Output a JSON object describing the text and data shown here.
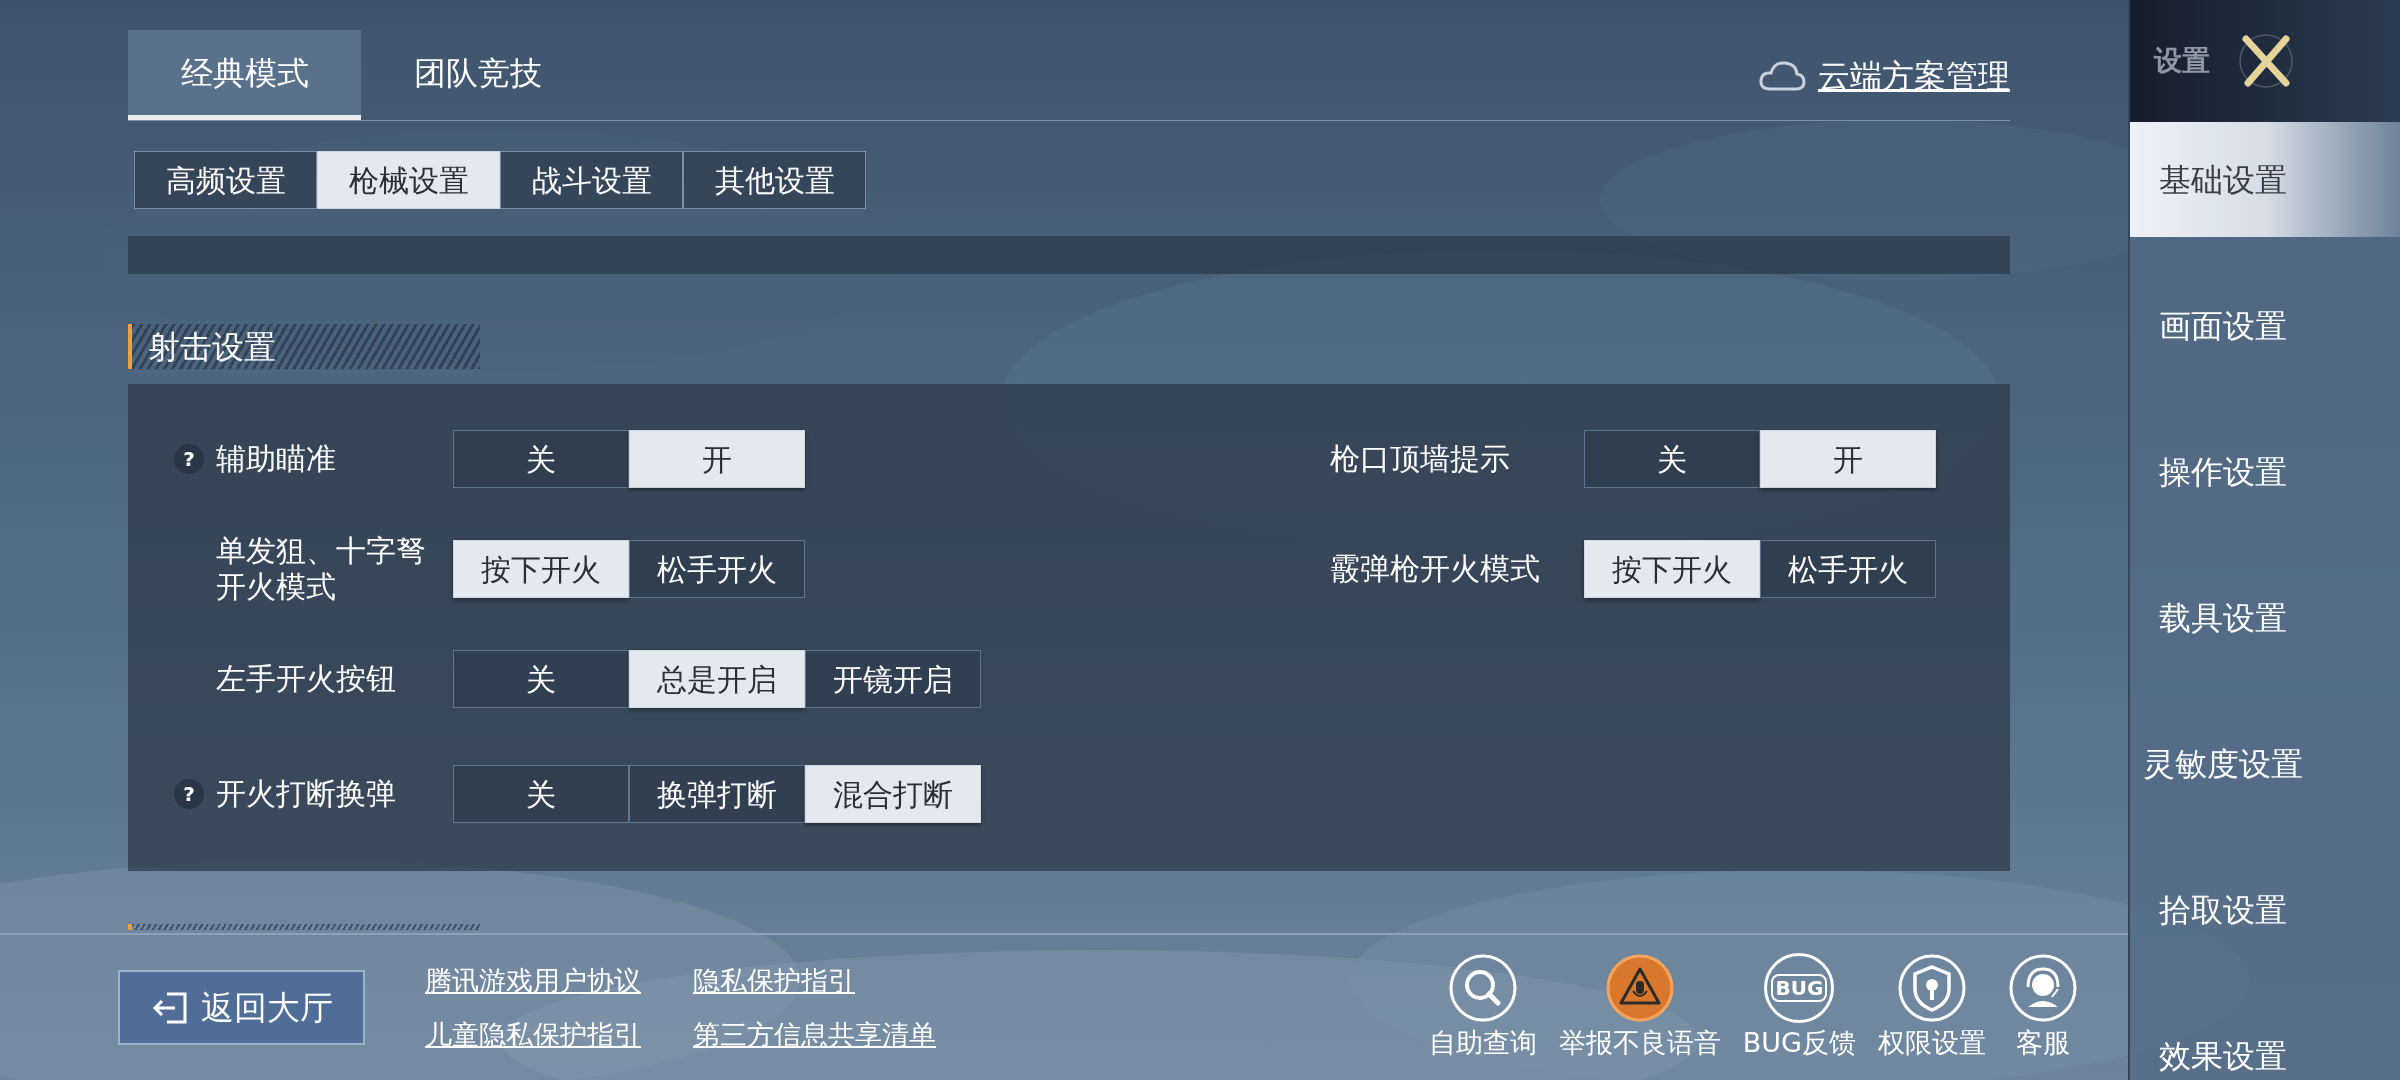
{
  "mode_tabs": [
    {
      "label": "经典模式",
      "selected": true
    },
    {
      "label": "团队竞技",
      "selected": false
    }
  ],
  "cloud_link": "云端方案管理",
  "sub_tabs": [
    {
      "label": "高频设置",
      "selected": false
    },
    {
      "label": "枪械设置",
      "selected": true
    },
    {
      "label": "战斗设置",
      "selected": false
    },
    {
      "label": "其他设置",
      "selected": false
    }
  ],
  "section": {
    "title": "射击设置",
    "rows": [
      {
        "left": {
          "label": "辅助瞄准",
          "help": "?",
          "options": [
            {
              "label": "关",
              "selected": false
            },
            {
              "label": "开",
              "selected": true
            }
          ]
        },
        "right": {
          "label": "枪口顶墙提示",
          "options": [
            {
              "label": "关",
              "selected": false
            },
            {
              "label": "开",
              "selected": true
            }
          ]
        }
      },
      {
        "left": {
          "label": "单发狙、十字弩开火模式",
          "options": [
            {
              "label": "按下开火",
              "selected": true
            },
            {
              "label": "松手开火",
              "selected": false
            }
          ]
        },
        "right": {
          "label": "霰弹枪开火模式",
          "options": [
            {
              "label": "按下开火",
              "selected": true
            },
            {
              "label": "松手开火",
              "selected": false
            }
          ]
        }
      },
      {
        "left": {
          "label": "左手开火按钮",
          "options": [
            {
              "label": "关",
              "selected": false
            },
            {
              "label": "总是开启",
              "selected": true
            },
            {
              "label": "开镜开启",
              "selected": false
            }
          ]
        }
      },
      {
        "left": {
          "label": "开火打断换弹",
          "help": "?",
          "options": [
            {
              "label": "关",
              "selected": false
            },
            {
              "label": "换弹打断",
              "selected": false
            },
            {
              "label": "混合打断",
              "selected": true
            }
          ]
        }
      }
    ]
  },
  "footer": {
    "back_button": "返回大厅",
    "links": [
      [
        "腾讯游戏用户协议",
        "儿童隐私保护指引"
      ],
      [
        "隐私保护指引",
        "第三方信息共享清单"
      ]
    ],
    "tools": [
      {
        "kind": "search",
        "label": "自助查询"
      },
      {
        "kind": "voice-alert",
        "label": "举报不良语音"
      },
      {
        "kind": "bug",
        "label": "BUG反馈",
        "badge": "BUG"
      },
      {
        "kind": "shield",
        "label": "权限设置"
      },
      {
        "kind": "headset",
        "label": "客服"
      }
    ]
  },
  "sidebar": {
    "title": "设置",
    "items": [
      {
        "label": "基础设置",
        "selected": true
      },
      {
        "label": "画面设置",
        "selected": false
      },
      {
        "label": "操作设置",
        "selected": false
      },
      {
        "label": "载具设置",
        "selected": false
      },
      {
        "label": "灵敏度设置",
        "selected": false
      },
      {
        "label": "拾取设置",
        "selected": false
      },
      {
        "label": "效果设置",
        "selected": false
      }
    ]
  }
}
